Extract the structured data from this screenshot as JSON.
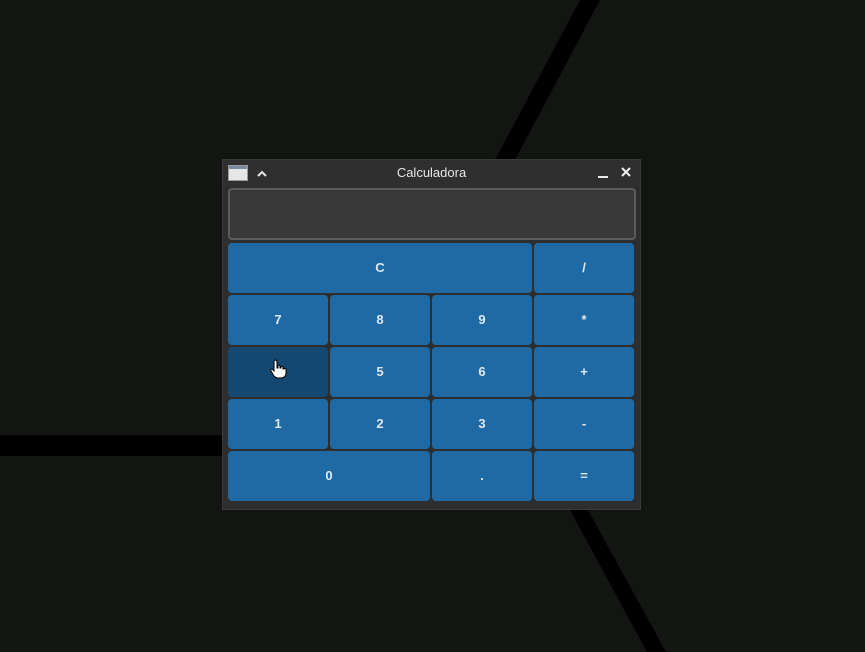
{
  "window": {
    "title": "Calculadora"
  },
  "titlebar_icons": {
    "app": "window-app-icon",
    "shade": "chevron-up-icon",
    "minimize": "minimize-icon",
    "close": "close-icon"
  },
  "display": {
    "value": ""
  },
  "keys": [
    {
      "label": "C"
    },
    {
      "label": "/"
    },
    {
      "label": "7"
    },
    {
      "label": "8"
    },
    {
      "label": "9"
    },
    {
      "label": "*"
    },
    {
      "label": "4"
    },
    {
      "label": "5"
    },
    {
      "label": "6"
    },
    {
      "label": "+"
    },
    {
      "label": "1"
    },
    {
      "label": "2"
    },
    {
      "label": "3"
    },
    {
      "label": "-"
    },
    {
      "label": "0"
    },
    {
      "label": "."
    },
    {
      "label": "="
    }
  ],
  "colors": {
    "key": "#1f6aa5",
    "key_pressed": "#144870",
    "background": "#131513"
  }
}
